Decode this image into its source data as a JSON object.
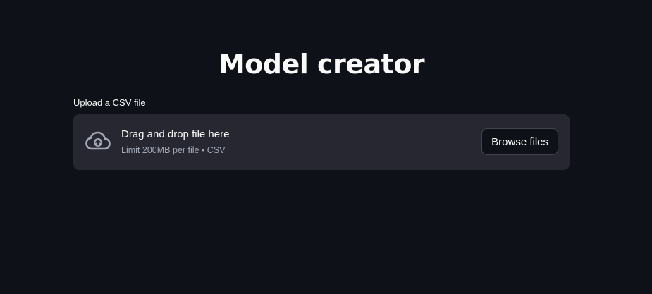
{
  "title": "Model creator",
  "uploader": {
    "label": "Upload a CSV file",
    "drop_text": "Drag and drop file here",
    "limit_text": "Limit 200MB per file • CSV",
    "browse_label": "Browse files",
    "icon": "cloud-upload-icon"
  },
  "colors": {
    "background": "#0e1117",
    "dropzone": "#262730",
    "text": "#fafafa",
    "muted_text": "#a3a8b8"
  }
}
